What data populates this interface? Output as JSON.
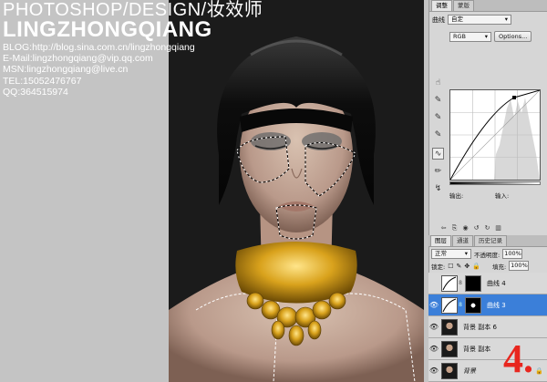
{
  "overlay": {
    "line1": "PHOTOSHOP/DESIGN/妆效师",
    "line2": "LINGZHONGQIANG",
    "info": [
      "BLOG:http://blog.sina.com.cn/lingzhongqiang",
      "E-Mail:lingzhongqiang@vip.qq.com",
      "MSN:lingzhongqiang@live.cn",
      "TEL:15052476767",
      "QQ:364515974"
    ]
  },
  "step_number": "4.",
  "adjustments_panel": {
    "tabs": [
      "调整",
      "蒙版"
    ],
    "curve_label": "曲线",
    "preset_value": "自定",
    "channel_value": "RGB",
    "options_label": "Options...",
    "output_label": "输出:",
    "input_label": "输入:"
  },
  "layers_panel": {
    "tabs": [
      "图层",
      "通道",
      "历史记录"
    ],
    "blend_mode": "正常",
    "opacity_label": "不透明度:",
    "opacity_value": "100%",
    "lock_label": "锁定:",
    "fill_label": "填充:",
    "fill_value": "100%",
    "layers": [
      {
        "name": "曲线 4",
        "type": "adjustment",
        "visible": false,
        "selected": false
      },
      {
        "name": "曲线 3",
        "type": "adjustment",
        "visible": true,
        "selected": true
      },
      {
        "name": "背景 副本 6",
        "type": "image",
        "visible": true,
        "selected": false
      },
      {
        "name": "背景 副本",
        "type": "image",
        "visible": true,
        "selected": false
      },
      {
        "name": "背景",
        "type": "image",
        "visible": true,
        "selected": false
      }
    ]
  },
  "colors": {
    "workspace": "#c4c4c4",
    "selected_layer": "#3b7fd9",
    "step_number": "#e8261e"
  }
}
